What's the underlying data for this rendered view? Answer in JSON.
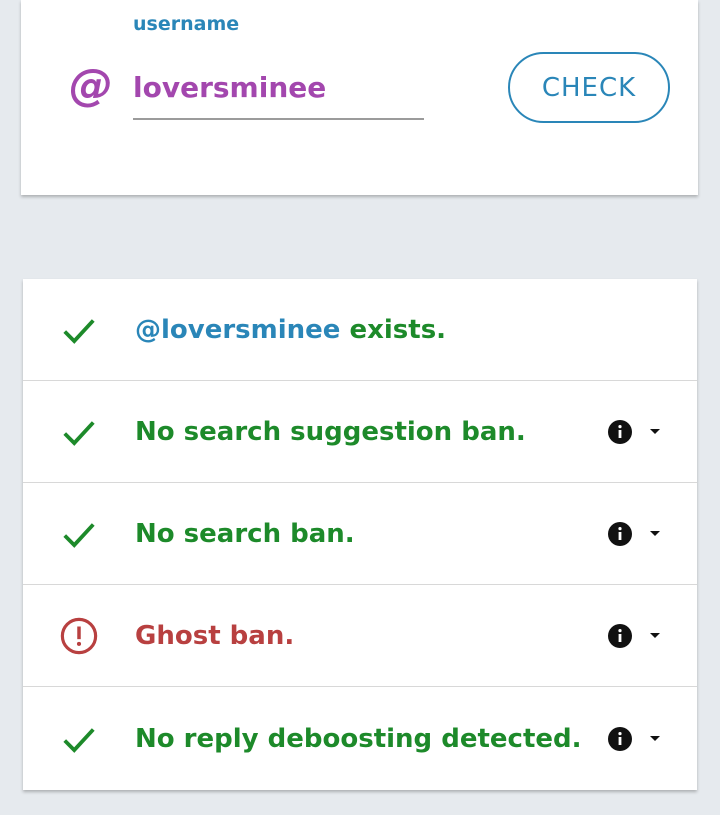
{
  "form": {
    "label": "username",
    "at_symbol": "@",
    "username_value": "loversminee",
    "check_label": "CHECK"
  },
  "results": [
    {
      "status": "ok",
      "icon": "check-icon",
      "handle": "@loversminee",
      "text": " exists.",
      "has_details": false
    },
    {
      "status": "ok",
      "icon": "check-icon",
      "text": "No search suggestion ban.",
      "has_details": true
    },
    {
      "status": "ok",
      "icon": "check-icon",
      "text": "No search ban.",
      "has_details": true
    },
    {
      "status": "bad",
      "icon": "alert-circle-icon",
      "text": "Ghost ban.",
      "has_details": true
    },
    {
      "status": "ok",
      "icon": "check-icon",
      "text": "No reply deboosting detected.",
      "has_details": true
    }
  ],
  "colors": {
    "accent": "#2a86b8",
    "username": "#a347ae",
    "ok": "#1d8a2a",
    "bad": "#b84040",
    "background": "#e6eaee"
  }
}
